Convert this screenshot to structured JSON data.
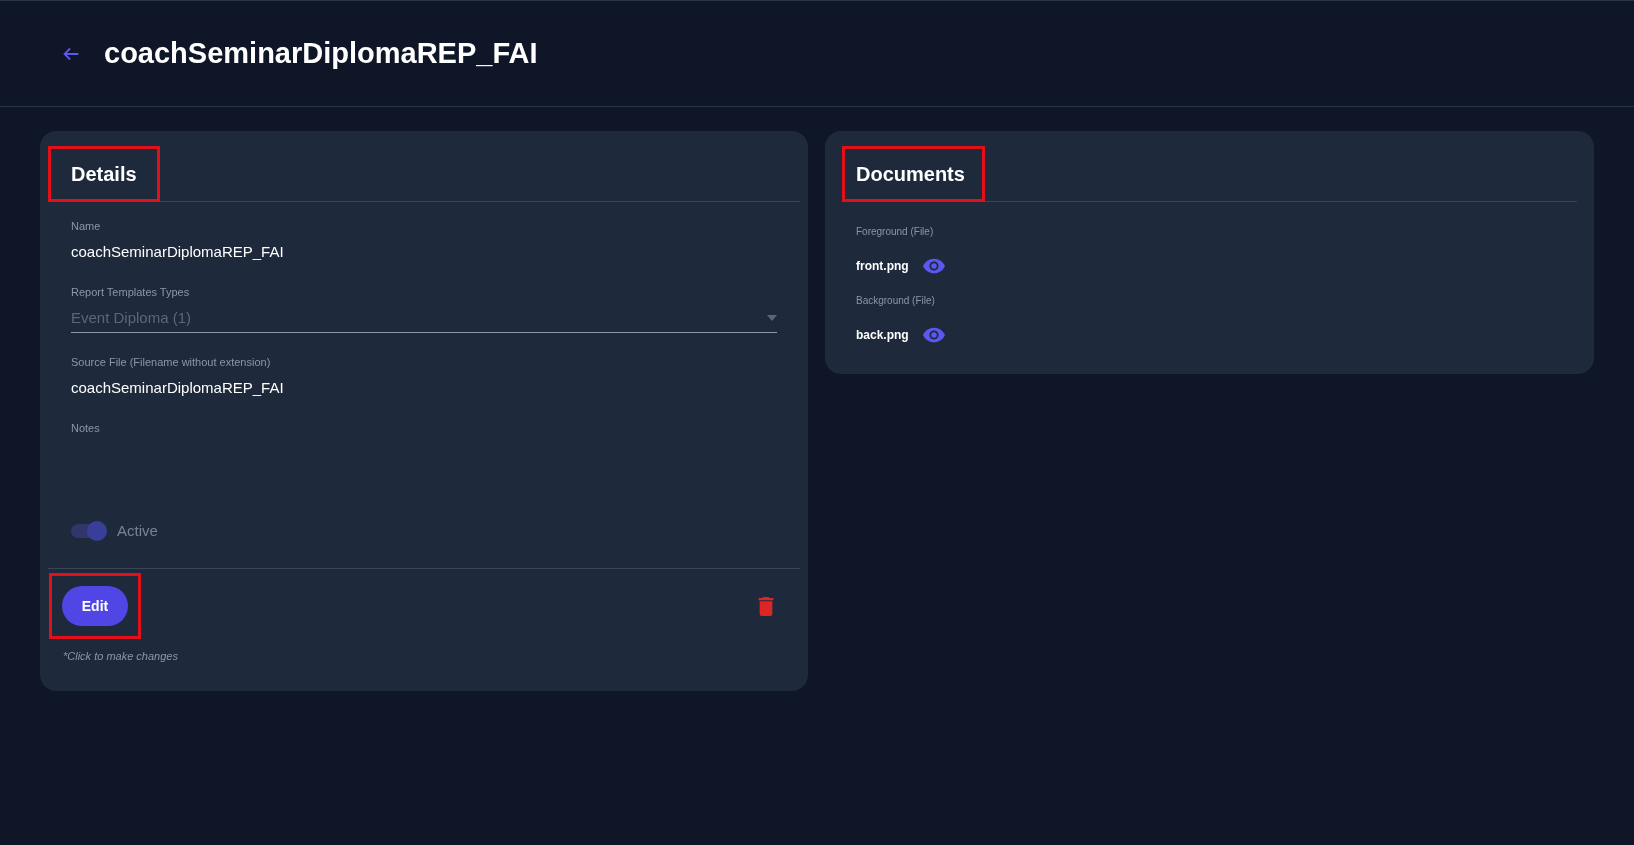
{
  "header": {
    "title": "coachSeminarDiplomaREP_FAI"
  },
  "details": {
    "title": "Details",
    "highlighted": true,
    "fields": [
      {
        "kind": "text",
        "label": "Name",
        "value": "coachSeminarDiplomaREP_FAI"
      },
      {
        "kind": "select",
        "label": "Report Templates Types",
        "value": "Event Diploma (1)",
        "disabled": true
      },
      {
        "kind": "text",
        "label": "Source File (Filename without extension)",
        "value": "coachSeminarDiplomaREP_FAI"
      },
      {
        "kind": "text",
        "label": "Notes"
      }
    ],
    "toggle": {
      "label": "Active",
      "on": true,
      "disabled": true
    },
    "edit_button": {
      "label": "Edit",
      "highlighted": true
    },
    "hint": "*Click to make changes"
  },
  "documents": {
    "title": "Documents",
    "highlighted": true,
    "files": [
      {
        "label": "Foreground (File)",
        "name": "front.png"
      },
      {
        "label": "Background (File)",
        "name": "back.png"
      }
    ]
  }
}
